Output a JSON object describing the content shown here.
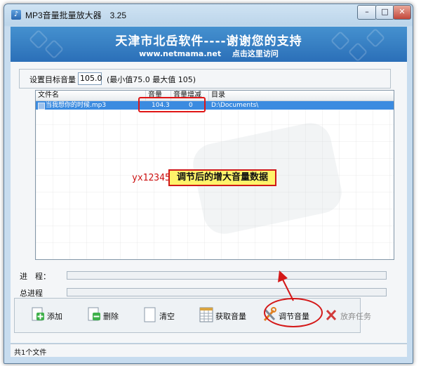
{
  "window": {
    "title": "MP3音量批量放大器　3.25",
    "controls": {
      "minimize": "–",
      "maximize": "□",
      "close": "✕"
    }
  },
  "banner": {
    "title": "天津市北岳软件----谢谢您的支持",
    "url": "www.netmama.net",
    "visit_link": "点击这里访问"
  },
  "target": {
    "label": "设置目标音量",
    "value": "105.0",
    "range_note": "(最小值75.0  最大值 105)"
  },
  "list": {
    "columns": [
      "文件名",
      "音量",
      "音量增减",
      "目录"
    ],
    "rows": [
      {
        "file": "当我想你的时候.mp3",
        "volume": "104.3",
        "change": "0",
        "dir": "D:\\Documents\\"
      }
    ]
  },
  "annotations": {
    "callout": "调节后的增大音量数据",
    "watermark": "yx12345.com"
  },
  "progress": {
    "label": "进　程：",
    "value": 0
  },
  "total_progress": {
    "label": "总进程",
    "value": 0
  },
  "toolbar": {
    "add": "添加",
    "delete": "删除",
    "clear": "清空",
    "get_volume": "获取音量",
    "adjust_volume": "调节音量",
    "abort_task": "放弃任务"
  },
  "status": {
    "text": "共1个文件"
  },
  "colors": {
    "accent": "#3b8be0",
    "banner": "#2b6fb8",
    "annotation_red": "#e01515",
    "callout_fill": "#fff36a"
  }
}
